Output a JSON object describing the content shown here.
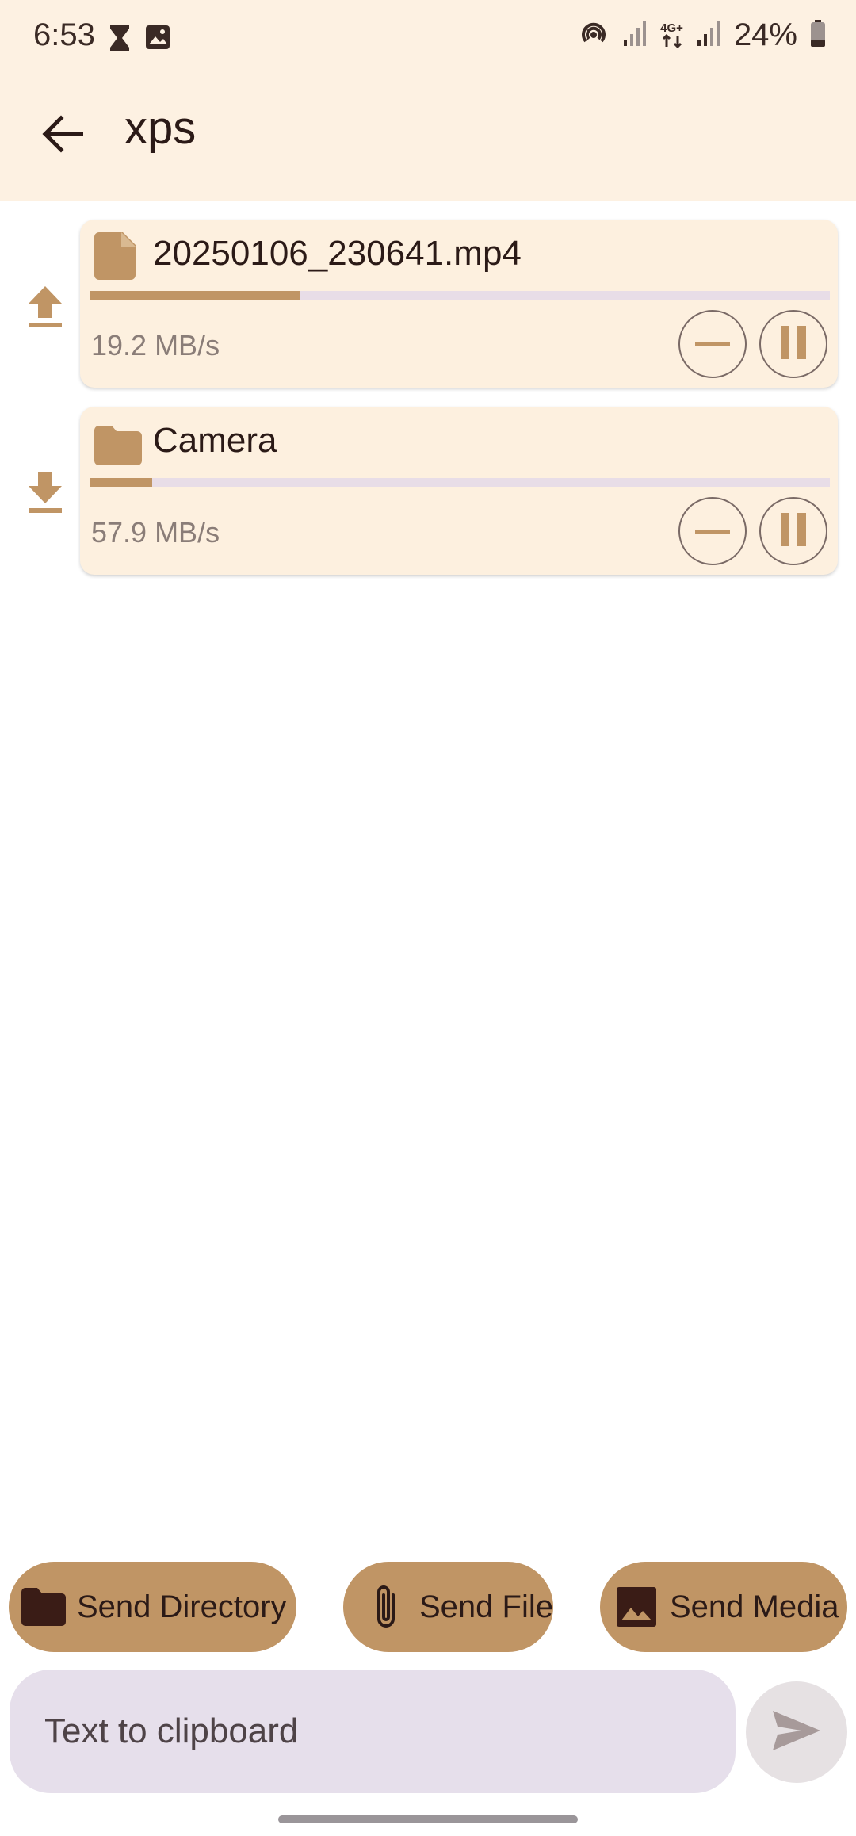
{
  "status_bar": {
    "time": "6:53",
    "battery_percent": "24%",
    "network_label": "4G+",
    "icons": [
      "hourglass-icon",
      "image-icon",
      "hotspot-icon",
      "signal-icon",
      "4g-icon",
      "signal-icon",
      "battery-icon"
    ]
  },
  "app_bar": {
    "title": "xps",
    "back_icon": "arrow-back-icon"
  },
  "transfers": [
    {
      "direction": "upload",
      "type": "file",
      "name": "20250106_230641.mp4",
      "progress": 0.285,
      "speed": "19.2 MB/s"
    },
    {
      "direction": "download",
      "type": "folder",
      "name": "Camera",
      "progress": 0.085,
      "speed": "57.9 MB/s"
    }
  ],
  "actions": {
    "send_directory": "Send Directory",
    "send_file": "Send File",
    "send_media": "Send Media"
  },
  "clipboard": {
    "placeholder": "Text to clipboard",
    "value": ""
  },
  "colors": {
    "accent": "#c09565",
    "header_bg": "#fdf1e2",
    "card_bg": "#fdf0df",
    "track": "#e8dde7",
    "input_bg": "#e6dfeb",
    "text_dark": "#2b1a17"
  }
}
